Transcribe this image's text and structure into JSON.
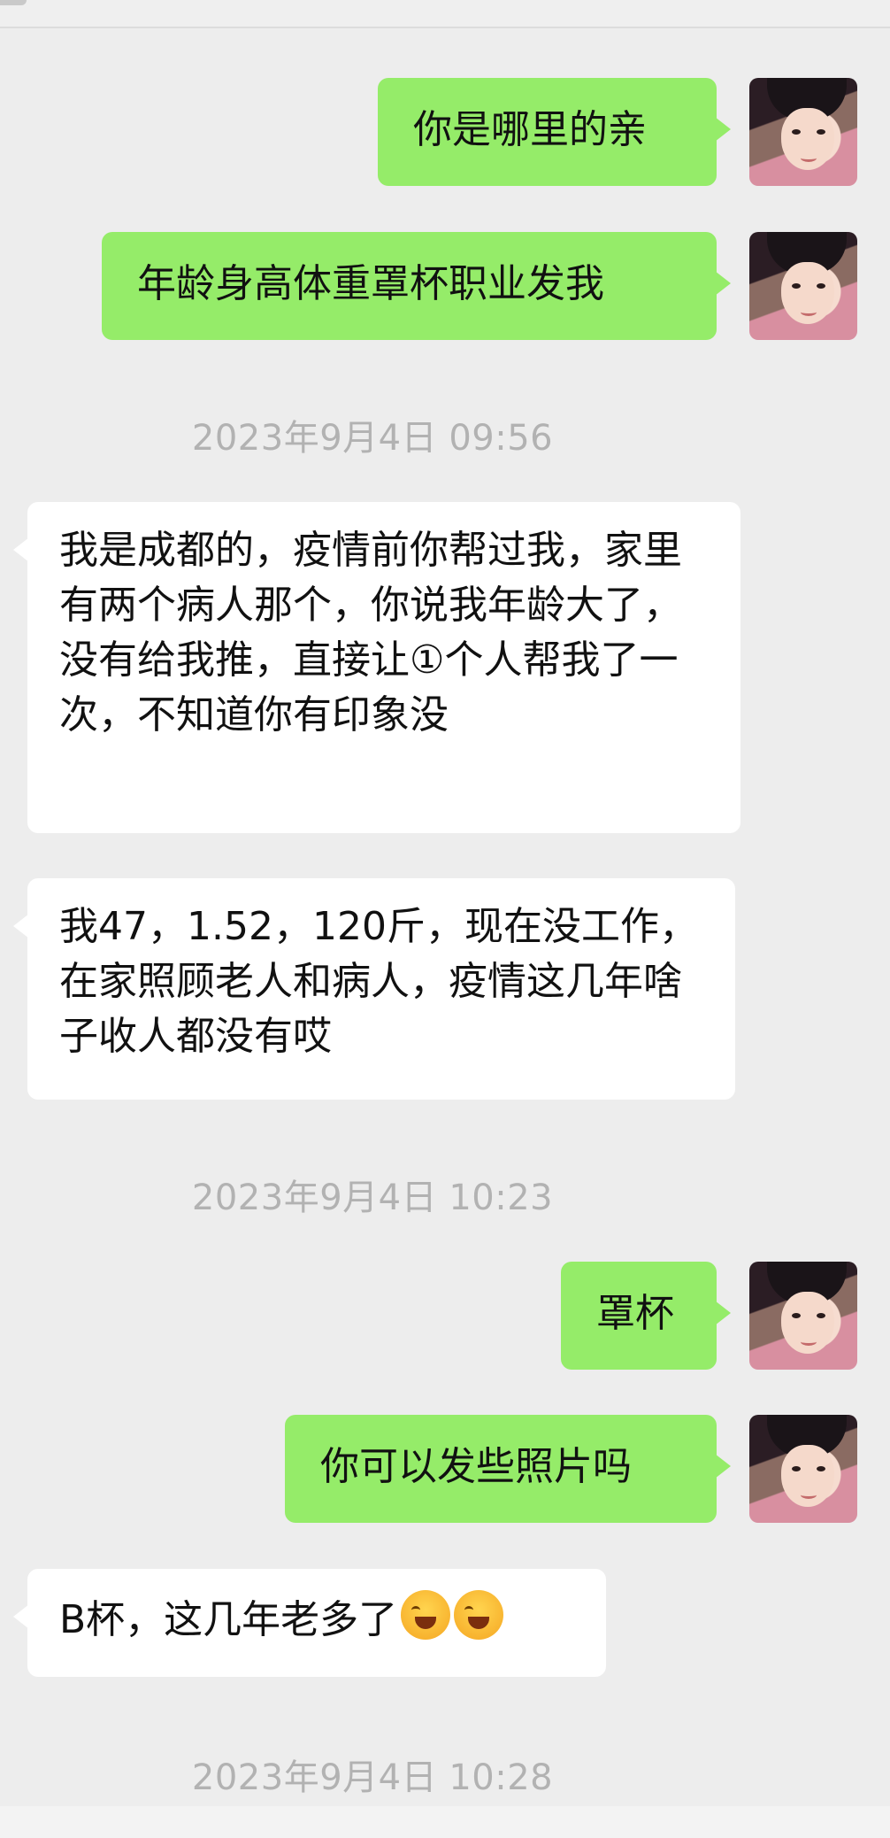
{
  "messages": [
    {
      "side": "me",
      "text": "你是哪里的亲"
    },
    {
      "side": "me",
      "text": "年龄身高体重罩杯职业发我"
    },
    {
      "timestamp": "2023年9月4日 09:56"
    },
    {
      "side": "them",
      "text": "我是成都的，疫情前你帮过我，家里有两个病人那个，你说我年龄大了，没有给我推，直接让①个人帮我了一次，不知道你有印象没"
    },
    {
      "side": "them",
      "text": "我47，1.52，120斤，现在没工作，在家照顾老人和病人，疫情这几年啥子收人都没有哎"
    },
    {
      "timestamp": "2023年9月4日 10:23"
    },
    {
      "side": "me",
      "text": "罩杯"
    },
    {
      "side": "me",
      "text": "你可以发些照片吗"
    },
    {
      "side": "them",
      "text": "B杯，这几年老多了",
      "emojis": [
        "crying-laughing",
        "crying-laughing"
      ]
    },
    {
      "timestamp": "2023年9月4日 10:28"
    }
  ],
  "colors": {
    "me_bubble": "#95ec69",
    "them_bubble": "#ffffff",
    "background": "#ededed",
    "timestamp": "#b2b2b2"
  }
}
